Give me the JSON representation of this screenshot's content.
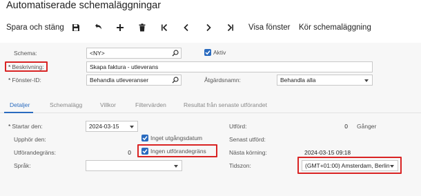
{
  "window": {
    "title": "Automatiserade schemaläggningar"
  },
  "toolbar": {
    "save_close_label": "Spara och stäng",
    "icons": [
      "save-icon",
      "undo-icon",
      "add-icon",
      "delete-icon",
      "first-icon",
      "previous-icon",
      "next-icon",
      "last-icon"
    ],
    "show_window_label": "Visa fönster",
    "run_schedule_label": "Kör schemaläggning"
  },
  "header": {
    "schema_label": "Schema:",
    "schema_value": "<NY>",
    "active_label": "Aktiv",
    "active_checked": true,
    "description_label": "Beskrivning:",
    "description_value": "Skapa faktura - utleverans",
    "screen_id_label": "Fönster-ID:",
    "screen_id_value": "Behandla utleveranser",
    "action_name_label": "Åtgärdsnamn:",
    "action_name_value": "Behandla alla"
  },
  "tabs": [
    {
      "label": "Detaljer",
      "active": true
    },
    {
      "label": "Schemalägg",
      "active": false
    },
    {
      "label": "Villkor",
      "active": false
    },
    {
      "label": "Filtervärden",
      "active": false
    },
    {
      "label": "Resultat från senaste utförandet",
      "active": false
    }
  ],
  "details": {
    "starts_on_label": "Startar den:",
    "starts_on_value": "2024-03-15",
    "expires_on_label": "Upphör den:",
    "no_expiration_label": "Inget utgångsdatum",
    "no_expiration_checked": true,
    "execution_limit_label": "Utförandegräns:",
    "execution_limit_value": "0",
    "no_execution_limit_label": "Ingen utförandegräns",
    "no_execution_limit_checked": true,
    "language_label": "Språk:",
    "language_value": "",
    "executed_label": "Utförd:",
    "executed_value": "0",
    "executed_unit": "Gånger",
    "last_executed_label": "Senast utförd:",
    "last_executed_value": "",
    "next_run_label": "Nästa körning:",
    "next_run_value": "2024-03-15 09:18",
    "time_zone_label": "Tidszon:",
    "time_zone_value": "(GMT+01:00) Amsterdam, Berlin"
  },
  "colors": {
    "accent": "#2a6bbf",
    "highlight": "#d92323"
  }
}
